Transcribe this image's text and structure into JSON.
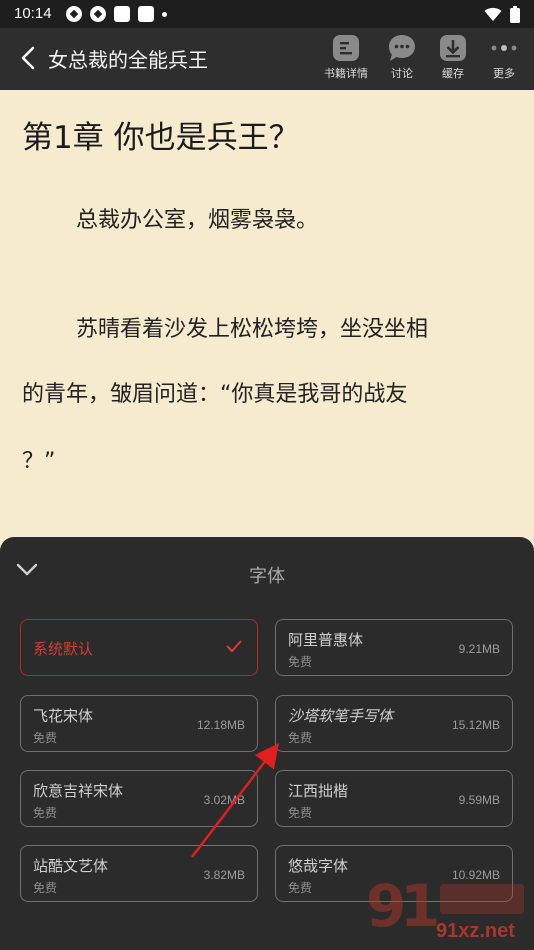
{
  "status": {
    "time": "10:14"
  },
  "appbar": {
    "title": "女总裁的全能兵王",
    "tools": [
      {
        "label": "书籍详情",
        "icon": "book-detail-icon"
      },
      {
        "label": "讨论",
        "icon": "chat-bubble-icon"
      },
      {
        "label": "缓存",
        "icon": "download-icon"
      },
      {
        "label": "更多",
        "icon": "more-dots-icon"
      }
    ]
  },
  "reader": {
    "chapter_title": "第1章 你也是兵王？",
    "paragraphs": [
      "总裁办公室，烟雾袅袅。",
      "苏晴看着沙发上松松垮垮，坐没坐相",
      "的青年，皱眉问道：“你真是我哥的战友",
      "？”"
    ]
  },
  "font_sheet": {
    "title": "字体",
    "fonts": [
      {
        "name": "系统默认",
        "free": "",
        "size": "",
        "selected": true
      },
      {
        "name": "阿里普惠体",
        "free": "免费",
        "size": "9.21MB",
        "selected": false
      },
      {
        "name": "飞花宋体",
        "free": "免费",
        "size": "12.18MB",
        "selected": false
      },
      {
        "name": "沙塔软笔手写体",
        "free": "免费",
        "size": "15.12MB",
        "selected": false
      },
      {
        "name": "欣意吉祥宋体",
        "free": "免费",
        "size": "3.02MB",
        "selected": false
      },
      {
        "name": "江西拙楷",
        "free": "免费",
        "size": "9.59MB",
        "selected": false
      },
      {
        "name": "站酷文艺体",
        "free": "免费",
        "size": "3.82MB",
        "selected": false
      },
      {
        "name": "悠哉字体",
        "free": "免费",
        "size": "10.92MB",
        "selected": false
      }
    ]
  },
  "watermark": {
    "text": "91xz.net"
  },
  "colors": {
    "accent": "#d43b3b",
    "paper": "#f6ebcf",
    "sheet": "#2b2b2b",
    "annotation": "#e02020"
  }
}
